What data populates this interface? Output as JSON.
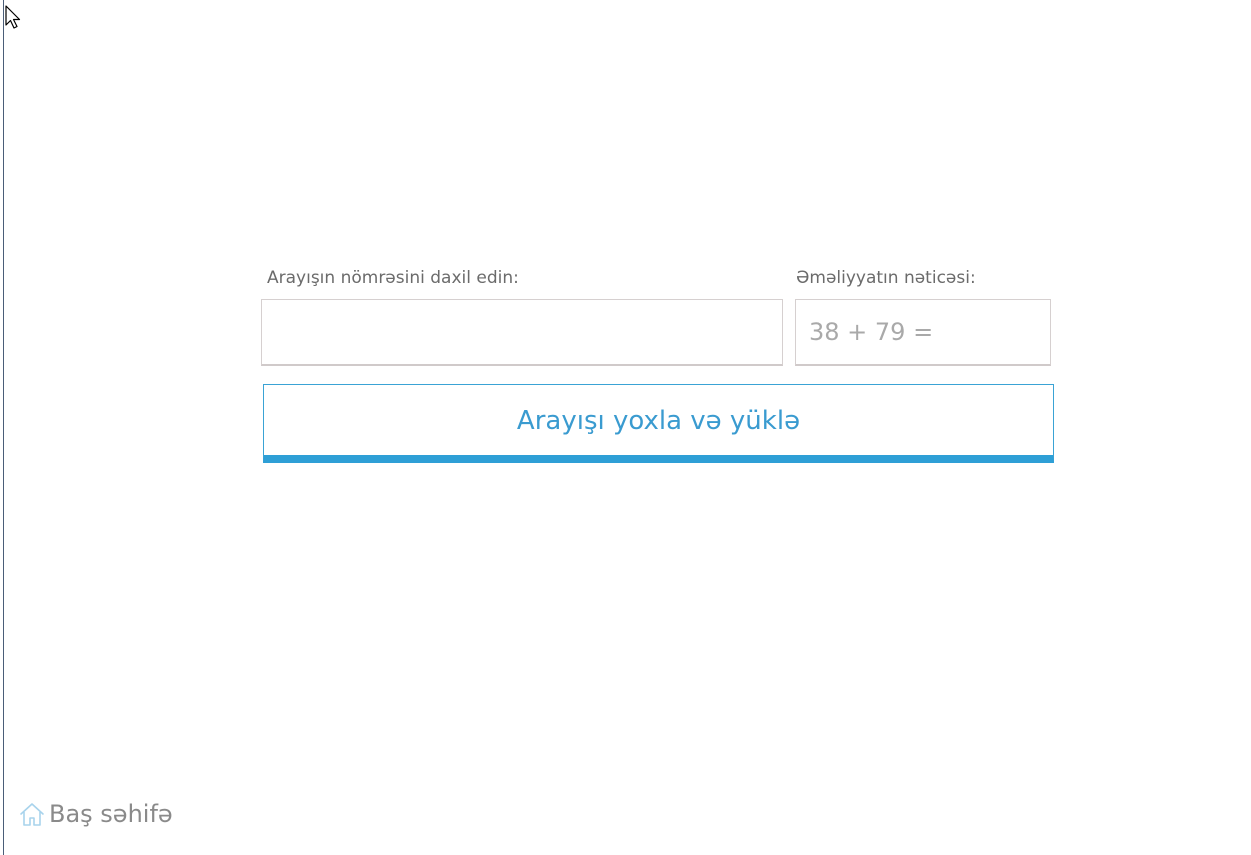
{
  "form": {
    "number_label": "Arayışın nömrəsini daxil edin:",
    "number_value": "",
    "result_label": "Əməliyyatın nəticəsi:",
    "result_placeholder": "38 + 79 =",
    "result_value": "",
    "submit_label": "Arayışı yoxla və yüklə"
  },
  "footer": {
    "home_label": "Baş səhifə",
    "home_icon": "home-icon"
  },
  "colors": {
    "accent": "#2e9fd6",
    "label_text": "#6b6b6b",
    "input_border": "#d6d0d0"
  }
}
